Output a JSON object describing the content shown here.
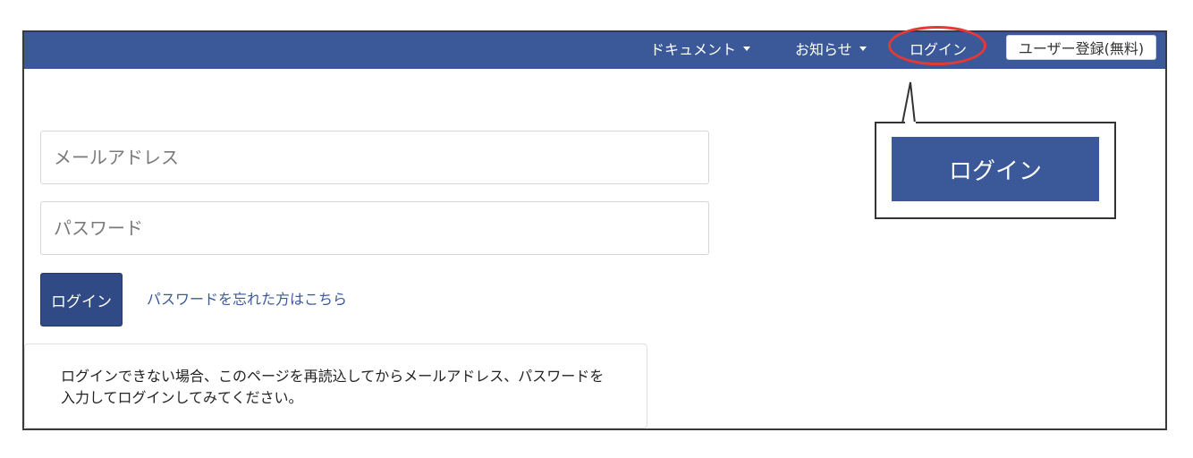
{
  "navbar": {
    "documents_label": "ドキュメント",
    "news_label": "お知らせ",
    "login_label": "ログイン",
    "register_label": "ユーザー登録(無料)"
  },
  "form": {
    "email_placeholder": "メールアドレス",
    "password_placeholder": "パスワード",
    "login_button_label": "ログイン",
    "forgot_password_label": "パスワードを忘れた方はこちら"
  },
  "notice": {
    "line1": "ログインできない場合、このページを再読込してからメールアドレス、パスワードを",
    "line2": "入力してログインしてみてください。"
  },
  "callout": {
    "button_label": "ログイン"
  },
  "colors": {
    "navbar_bg": "#3b5998",
    "highlight": "#e53935",
    "primary_button": "#2f4a85"
  }
}
